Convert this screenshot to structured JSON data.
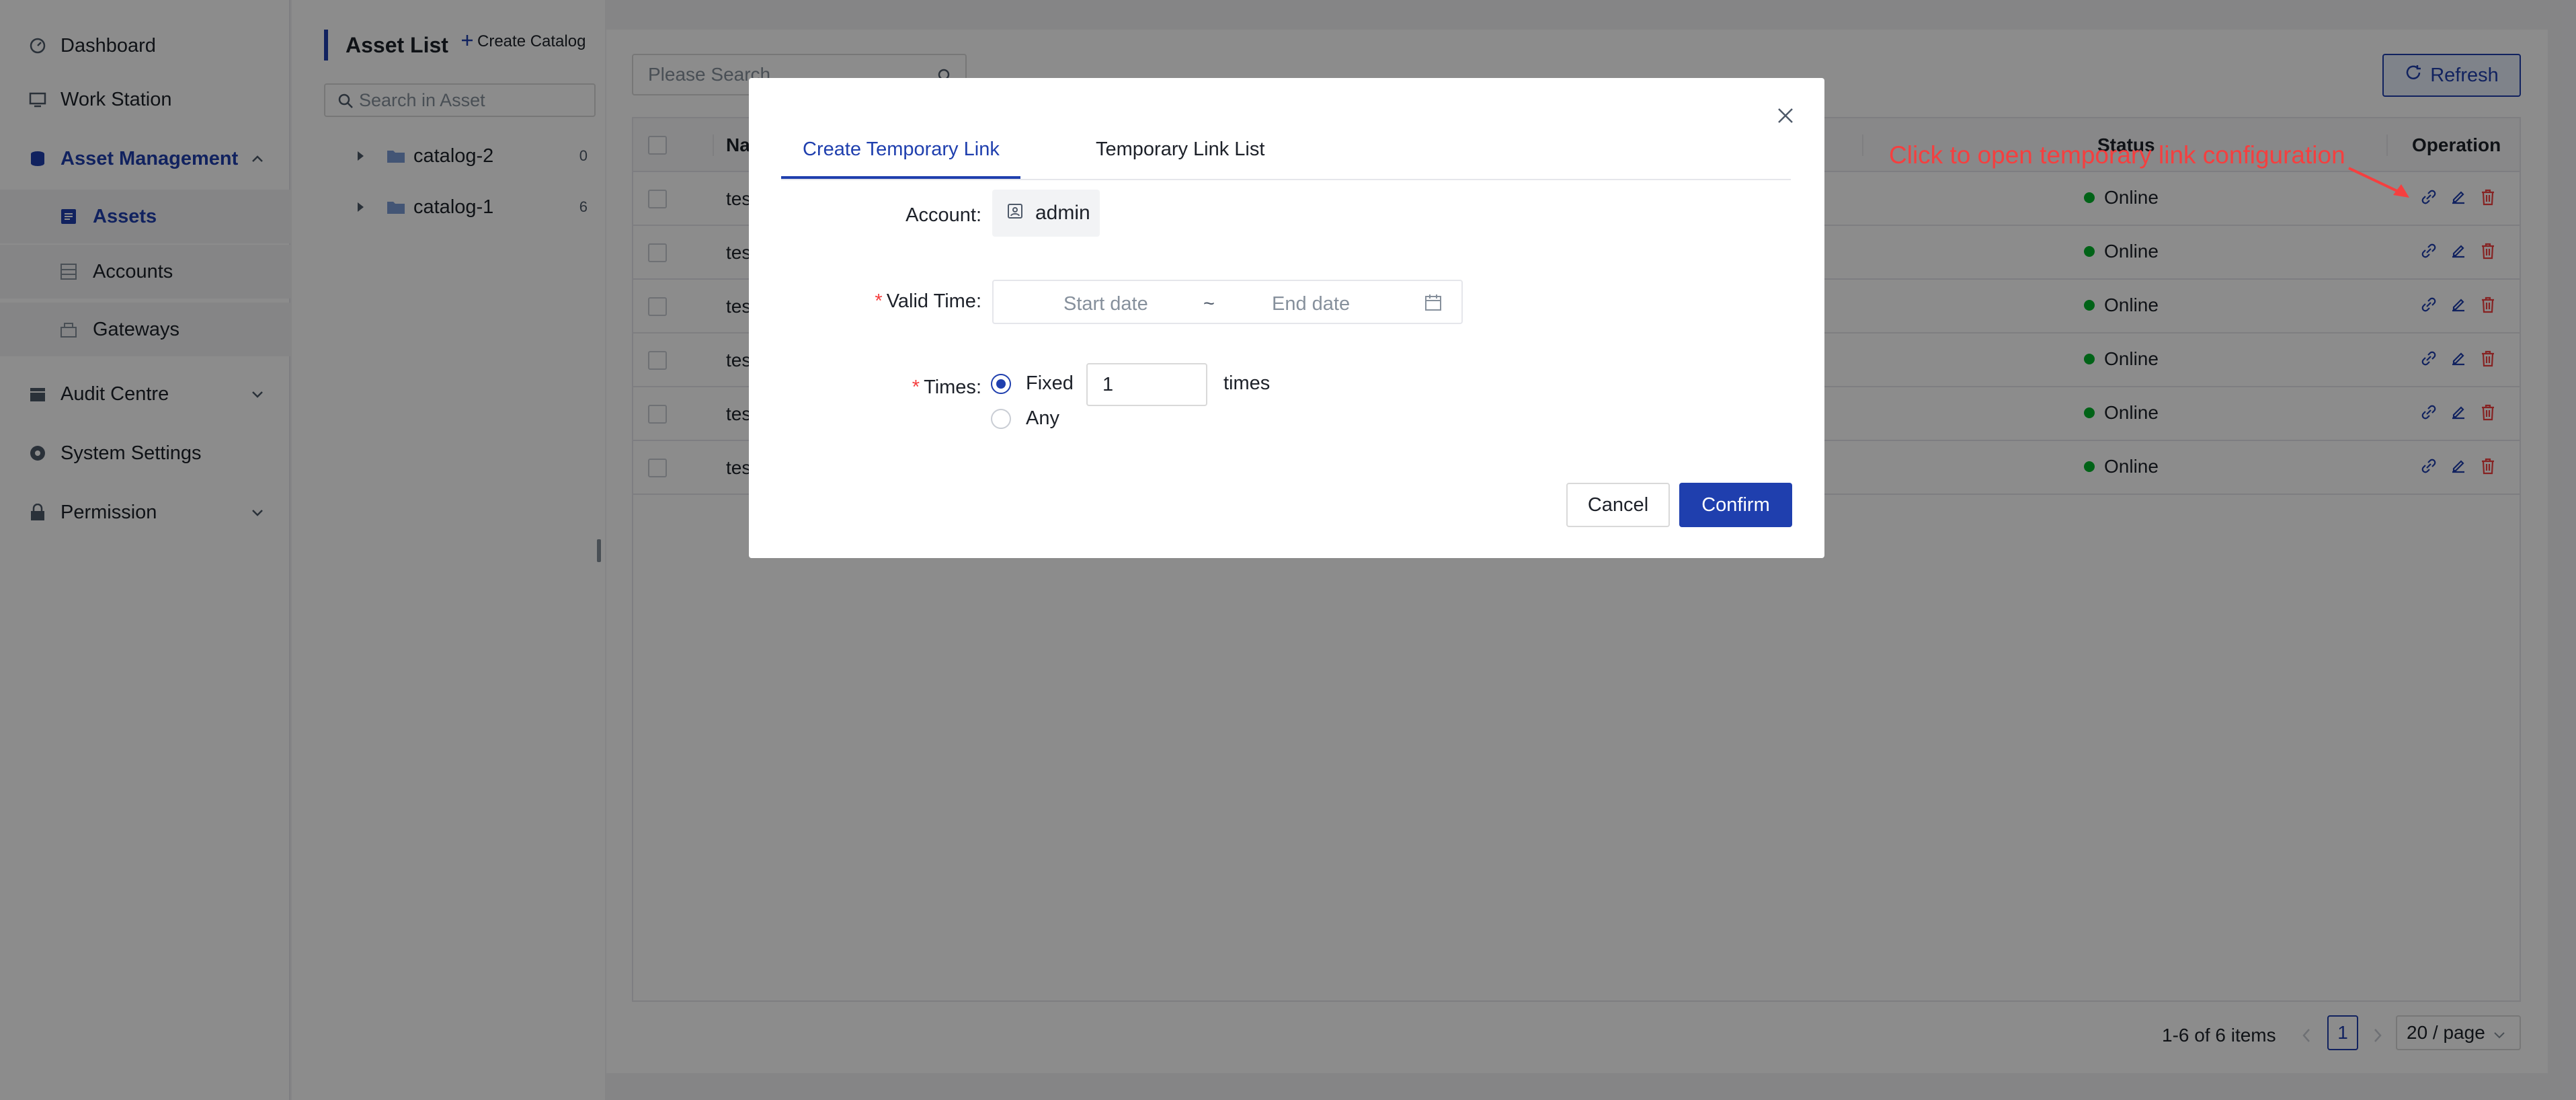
{
  "sidebar": {
    "items": [
      {
        "label": "Dashboard",
        "icon": "dashboard-icon"
      },
      {
        "label": "Work Station",
        "icon": "monitor-icon"
      },
      {
        "label": "Asset Management",
        "icon": "database-icon"
      },
      {
        "label": "Assets",
        "icon": "list-icon"
      },
      {
        "label": "Accounts",
        "icon": "table-icon"
      },
      {
        "label": "Gateways",
        "icon": "gateway-icon"
      },
      {
        "label": "Audit Centre",
        "icon": "calendar-icon"
      },
      {
        "label": "System Settings",
        "icon": "settings-icon"
      },
      {
        "label": "Permission",
        "icon": "lock-icon"
      }
    ]
  },
  "catalog": {
    "title": "Asset List",
    "create_label": "Create Catalog",
    "search_placeholder": "Search in Asset",
    "tree": [
      {
        "label": "catalog-2",
        "count": "0"
      },
      {
        "label": "catalog-1",
        "count": "6"
      }
    ]
  },
  "main": {
    "search_placeholder": "Please Search",
    "refresh_label": "Refresh",
    "columns": {
      "name": "Na",
      "status": "Status",
      "operation": "Operation"
    },
    "rows": [
      {
        "name": "tes",
        "status": "Online"
      },
      {
        "name": "tes",
        "status": "Online"
      },
      {
        "name": "tes",
        "status": "Online"
      },
      {
        "name": "tes",
        "status": "Online"
      },
      {
        "name": "tes",
        "status": "Online"
      },
      {
        "name": "tes",
        "status": "Online"
      }
    ],
    "pagination": {
      "summary": "1-6 of 6 items",
      "current_page": "1",
      "page_size": "20 / page"
    }
  },
  "modal": {
    "tabs": {
      "create": "Create Temporary Link",
      "list": "Temporary Link List"
    },
    "account_label": "Account",
    "account_value": "admin",
    "valid_time_label": "Valid Time",
    "start_placeholder": "Start date",
    "range_separator": "~",
    "end_placeholder": "End date",
    "times_label": "Times",
    "option_fixed": "Fixed",
    "times_value": "1",
    "times_unit": "times",
    "option_any": "Any",
    "cancel_label": "Cancel",
    "confirm_label": "Confirm"
  },
  "annotation": {
    "text": "Click to open temporary link configuration"
  },
  "colors": {
    "primary": "#1f3fae",
    "online": "#00b42a",
    "danger": "#f53f3f"
  }
}
